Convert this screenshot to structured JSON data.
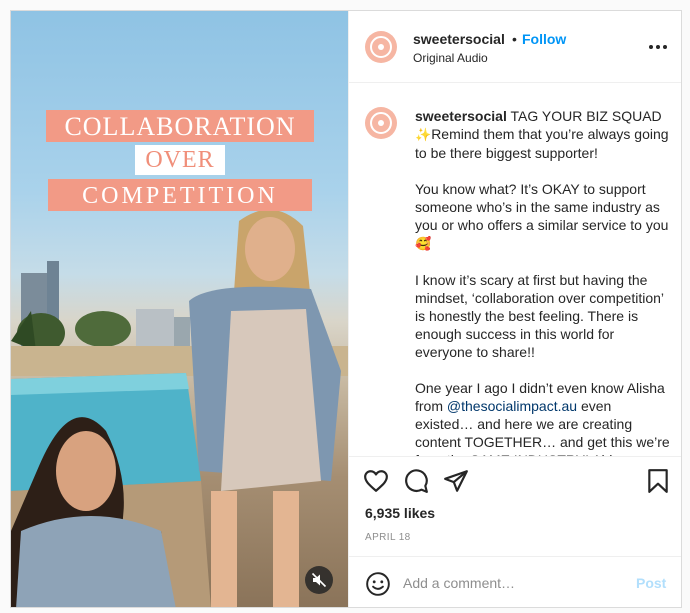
{
  "post": {
    "username": "sweetersocial",
    "separator": "•",
    "follow_label": "Follow",
    "audio_label": "Original Audio",
    "icons": {
      "more": "more-options-icon",
      "mute": "sound-off-icon",
      "like": "heart-icon",
      "comment": "comment-bubble-icon",
      "share": "paper-plane-icon",
      "save": "bookmark-icon",
      "emoji": "smiley-icon"
    }
  },
  "media": {
    "overlay_lines": [
      "COLLABORATION",
      "OVER",
      "COMPETITION"
    ],
    "colors": {
      "overlay_bg": "#f29a86",
      "overlay_over_text": "#f08f7a"
    }
  },
  "caption": {
    "username": "sweetersocial",
    "line1": " TAG YOUR BIZ SQUAD ",
    "line1_emoji": "✨",
    "line1_rest": "Remind them that you’re always going to be there biggest supporter!",
    "p2": "You know what? It’s OKAY to support someone who’s in the same industry as you or who offers a similar service to you ",
    "p2_emoji": "🥰",
    "p3": "I know it’s scary at first but having the mindset, ‘collaboration over competition’ is honestly the best feeling. There is enough success in this world for everyone to share!!",
    "p4_start": "One year I ago I didn’t even know Alisha from ",
    "p4_mention": "@thesocialimpact.au",
    "p4_end": " even existed… and here we are creating content TOGETHER… and get this we’re from the SAME INDUSTRY! Ahh"
  },
  "stats": {
    "likes": "6,935 likes",
    "date": "APRIL 18"
  },
  "comment": {
    "placeholder": "Add a comment…",
    "post_label": "Post"
  },
  "colors": {
    "link_blue": "#0095f6",
    "post_disabled": "#b2dffc",
    "avatar": "#f6b6a3",
    "mention": "#00376b"
  }
}
